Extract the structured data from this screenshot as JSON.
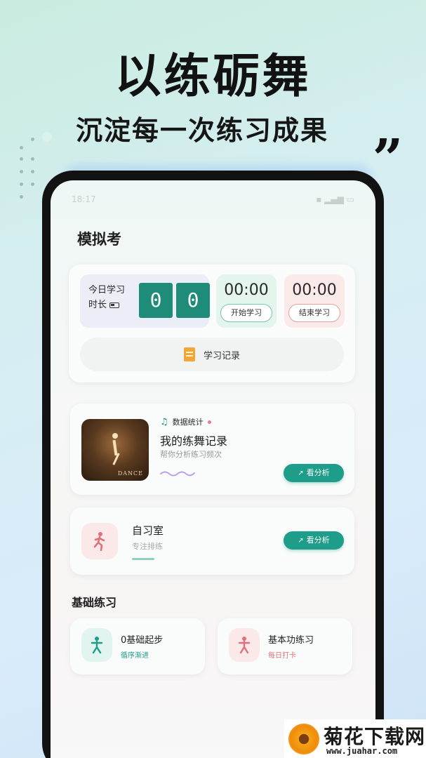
{
  "promo": {
    "title": "以练砺舞",
    "subtitle": "沉淀每一次练习成果",
    "quote_mark": "„"
  },
  "status_bar": {
    "time": "18:17",
    "icons": ""
  },
  "page_title": "模拟考",
  "today": {
    "label": "今日学习时长",
    "digits": [
      "0",
      "0"
    ],
    "start": {
      "time": "00:00",
      "button": "开始学习"
    },
    "end": {
      "time": "00:00",
      "button": "结束学习"
    },
    "record_label": "学习记录"
  },
  "dance_record": {
    "tag": "数据统计",
    "title": "我的练舞记录",
    "subtitle": "帮你分析练习频次",
    "image_word": "DANCE",
    "button": "看分析"
  },
  "study_room": {
    "title": "自习室",
    "subtitle": "专注排练",
    "button": "看分析"
  },
  "basic_section": {
    "title": "基础练习",
    "items": [
      {
        "title": "0基础起步",
        "subtitle": "循序渐进",
        "color": "#1e9d8a"
      },
      {
        "title": "基本功练习",
        "subtitle": "每日打卡",
        "color": "#e0707a"
      }
    ]
  },
  "watermark": {
    "text": "菊花下载网",
    "url": "www.juahar.com"
  },
  "colors": {
    "accent_green": "#1e8c78",
    "accent_pink": "#e0707a",
    "record_orange": "#f2a735"
  }
}
